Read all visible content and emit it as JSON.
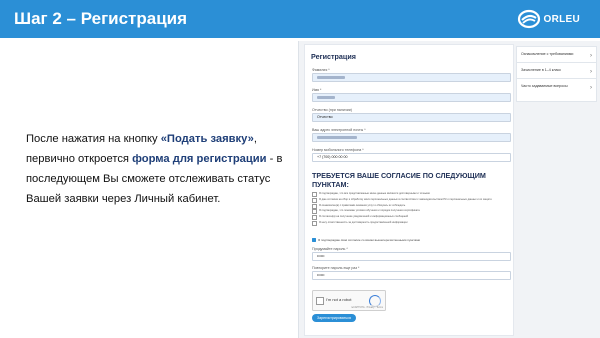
{
  "header": {
    "title": "Шаг 2 – Регистрация",
    "logo_text": "ORLEU"
  },
  "description": {
    "part1": "После нажатия на кнопку ",
    "link1": "«Подать заявку»",
    "part2": ", первично откроется ",
    "link2": "форма для регистрации",
    "part3": " - в последующем Вы сможете отслеживать статус Вашей заявки через Личный кабинет."
  },
  "form": {
    "title": "Регистрация",
    "fields": [
      {
        "label": "Фамилия *"
      },
      {
        "label": "Имя *"
      },
      {
        "label": "Отчество (при наличии)",
        "value": "Отчество"
      },
      {
        "label": "Ваш адрес электронной почты *"
      },
      {
        "label": "Номер мобильного телефона *",
        "value": "+7 (700) 000 00 00"
      }
    ],
    "consent_title": "ТРЕБУЕТСЯ ВАШЕ СОГЛАСИЕ ПО СЛЕДУЮЩИМ ПУНКТАМ:",
    "consent_items": [
      "Я подтверждаю, что все представленные мною данные являются достоверными и точными",
      "Я даю согласие на сбор и обработку моих персональных данных в соответствии с законодательством РК о персональных данных и их защите",
      "Я ознакомлен(а) с правилами оказания услуг и обязуюсь их соблюдать",
      "Я подтверждаю, что понимаю условия обучения и порядок получения сертификата",
      "Я согласен(а) на получение уведомлений и информационных сообщений",
      "Я несу ответственность за достоверность предоставленной информации"
    ],
    "check_all_label": "Я подтверждаю своё согласие со всеми вышеперечисленными пунктами",
    "password_label": "Придумайте пароль *",
    "password_value": "••••••",
    "password_repeat_label": "Повторите пароль еще раз *",
    "password_repeat_value": "••••••",
    "captcha_label": "I'm not a robot",
    "captcha_footer": "reCAPTCHA · Privacy · Terms",
    "submit_label": "Зарегистрироваться"
  },
  "sidebar": {
    "items": [
      {
        "label": "Ознакомление с требованиями"
      },
      {
        "label": "Зачисление в 1–4 класс"
      },
      {
        "label": "Часто задаваемые вопросы"
      }
    ]
  },
  "colors": {
    "accent": "#2b8fd6",
    "heading": "#1e2f55"
  },
  "icons": {
    "logo": "orleu-swirl-icon",
    "chevron": "chevron-right-icon"
  }
}
